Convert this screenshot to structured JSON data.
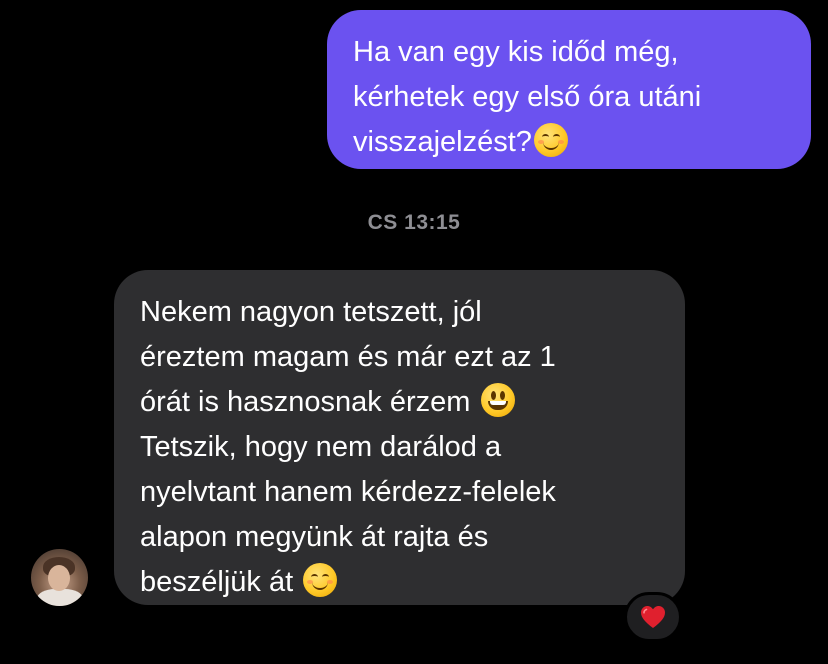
{
  "messages": {
    "outgoing": {
      "lines": [
        "Ha van egy kis időd még,",
        "kérhetek egy első óra utáni",
        "visszajelzést?"
      ],
      "emoji": "smiling-face-icon"
    },
    "timestamp": "CS 13:15",
    "incoming": {
      "lines": [
        "Nekem nagyon tetszett, jól",
        "éreztem magam és már ezt az 1",
        "órát is hasznosnak érzem",
        "Tetszik, hogy nem darálod a",
        "nyelvtant hanem kérdezz-felelek",
        "alapon megyünk át rajta és",
        "beszéljük át"
      ],
      "emojis": [
        "grinning-face-icon",
        "smiling-face-icon"
      ],
      "reaction": "red-heart-icon"
    }
  },
  "colors": {
    "outgoing_bubble": "#6b52f0",
    "incoming_bubble": "#2e2e30",
    "background": "#000000",
    "timestamp_text": "#8e8e93",
    "reaction_heart": "#e0202e"
  }
}
